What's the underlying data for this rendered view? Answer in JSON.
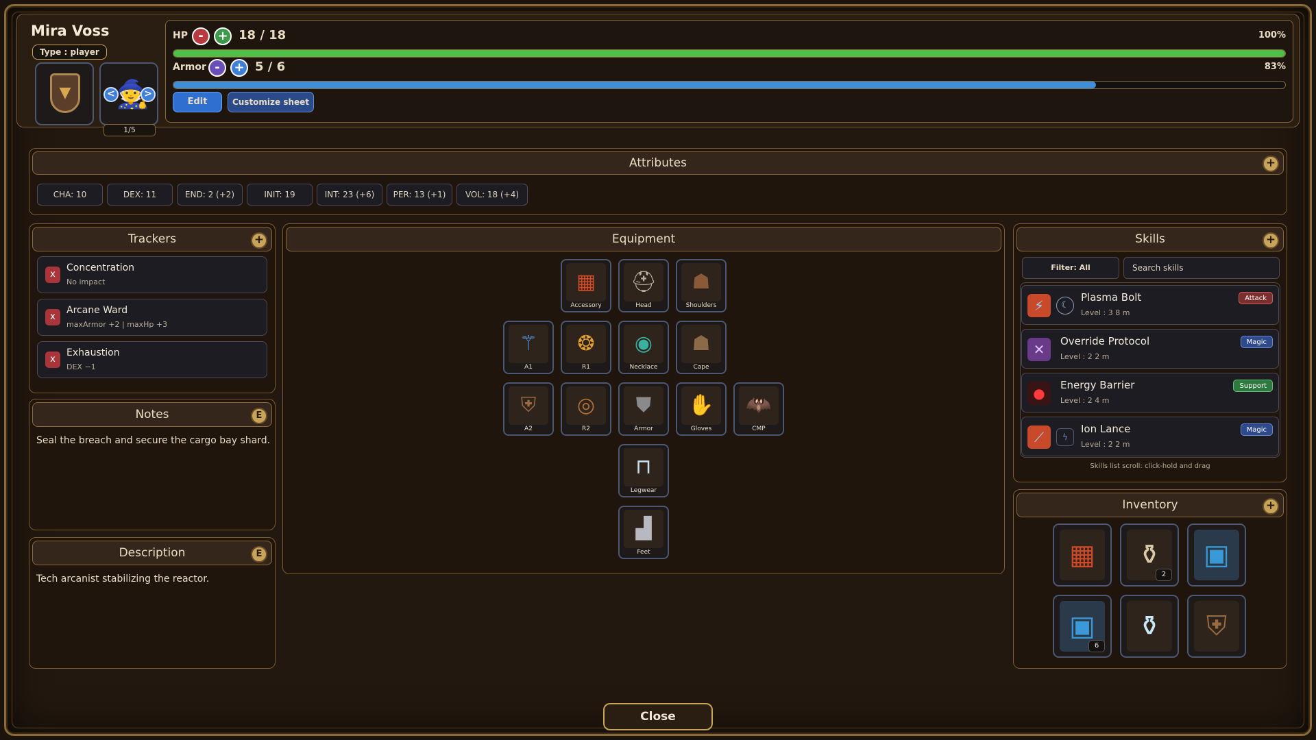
{
  "character": {
    "name": "Mira Voss",
    "type_label": "Type : player",
    "portrait_counter": "1/5"
  },
  "hp": {
    "label": "HP",
    "value": "18 / 18",
    "percent_label": "100%",
    "fraction": 1.0,
    "color": "#4fbf4a"
  },
  "armor": {
    "label": "Armor",
    "value": "5 / 6",
    "percent_label": "83%",
    "fraction": 0.83,
    "color": "#3f8fd8"
  },
  "buttons": {
    "edit": "Edit",
    "customize": "Customize sheet",
    "close": "Close",
    "minus": "-",
    "plus": "+",
    "prev": "<",
    "next": ">"
  },
  "attributes": {
    "title": "Attributes",
    "items": [
      "CHA: 10",
      "DEX: 11",
      "END: 2 (+2)",
      "INIT: 19",
      "INT: 23 (+6)",
      "PER: 13 (+1)",
      "VOL: 18 (+4)"
    ]
  },
  "trackers": {
    "title": "Trackers",
    "items": [
      {
        "name": "Concentration",
        "detail": "No impact"
      },
      {
        "name": "Arcane Ward",
        "detail": "maxArmor +2 | maxHp +3"
      },
      {
        "name": "Exhaustion",
        "detail": "DEX −1"
      }
    ]
  },
  "notes": {
    "title": "Notes",
    "text": "Seal the breach and secure the cargo bay shard."
  },
  "description": {
    "title": "Description",
    "text": "Tech arcanist stabilizing the reactor."
  },
  "equipment": {
    "title": "Equipment",
    "slots": {
      "accessory": "Accessory",
      "head": "Head",
      "shoulders": "Shoulders",
      "a1": "A1",
      "r1": "R1",
      "necklace": "Necklace",
      "cape": "Cape",
      "a2": "A2",
      "r2": "R2",
      "armor": "Armor",
      "gloves": "Gloves",
      "cmp": "CMP",
      "legwear": "Legwear",
      "feet": "Feet"
    }
  },
  "skills": {
    "title": "Skills",
    "filter": "Filter: All",
    "search_placeholder": "Search skills",
    "hint": "Skills list scroll: click-hold and drag",
    "items": [
      {
        "name": "Plasma Bolt",
        "level": "Level : 3  8 m",
        "tag": "Attack",
        "tag_color": "#7a2e2e"
      },
      {
        "name": "Override Protocol",
        "level": "Level : 2  2 m",
        "tag": "Magic",
        "tag_color": "#2f4a8a"
      },
      {
        "name": "Energy Barrier",
        "level": "Level : 2  4 m",
        "tag": "Support",
        "tag_color": "#2e7a3e"
      },
      {
        "name": "Ion Lance",
        "level": "Level : 2  2 m",
        "tag": "Magic",
        "tag_color": "#2f4a8a"
      }
    ]
  },
  "inventory": {
    "title": "Inventory",
    "items": [
      {
        "icon": "banner-icon",
        "qty": ""
      },
      {
        "icon": "potion-bottle-icon",
        "qty": "2"
      },
      {
        "icon": "scroll-blue-icon",
        "qty": ""
      },
      {
        "icon": "scroll-blue-icon",
        "qty": "6"
      },
      {
        "icon": "feather-bottle-icon",
        "qty": ""
      },
      {
        "icon": "shield-paw-icon",
        "qty": ""
      }
    ]
  },
  "icons": {
    "add_symbol": "+",
    "edit_symbol": "E",
    "remove_symbol": "x"
  }
}
